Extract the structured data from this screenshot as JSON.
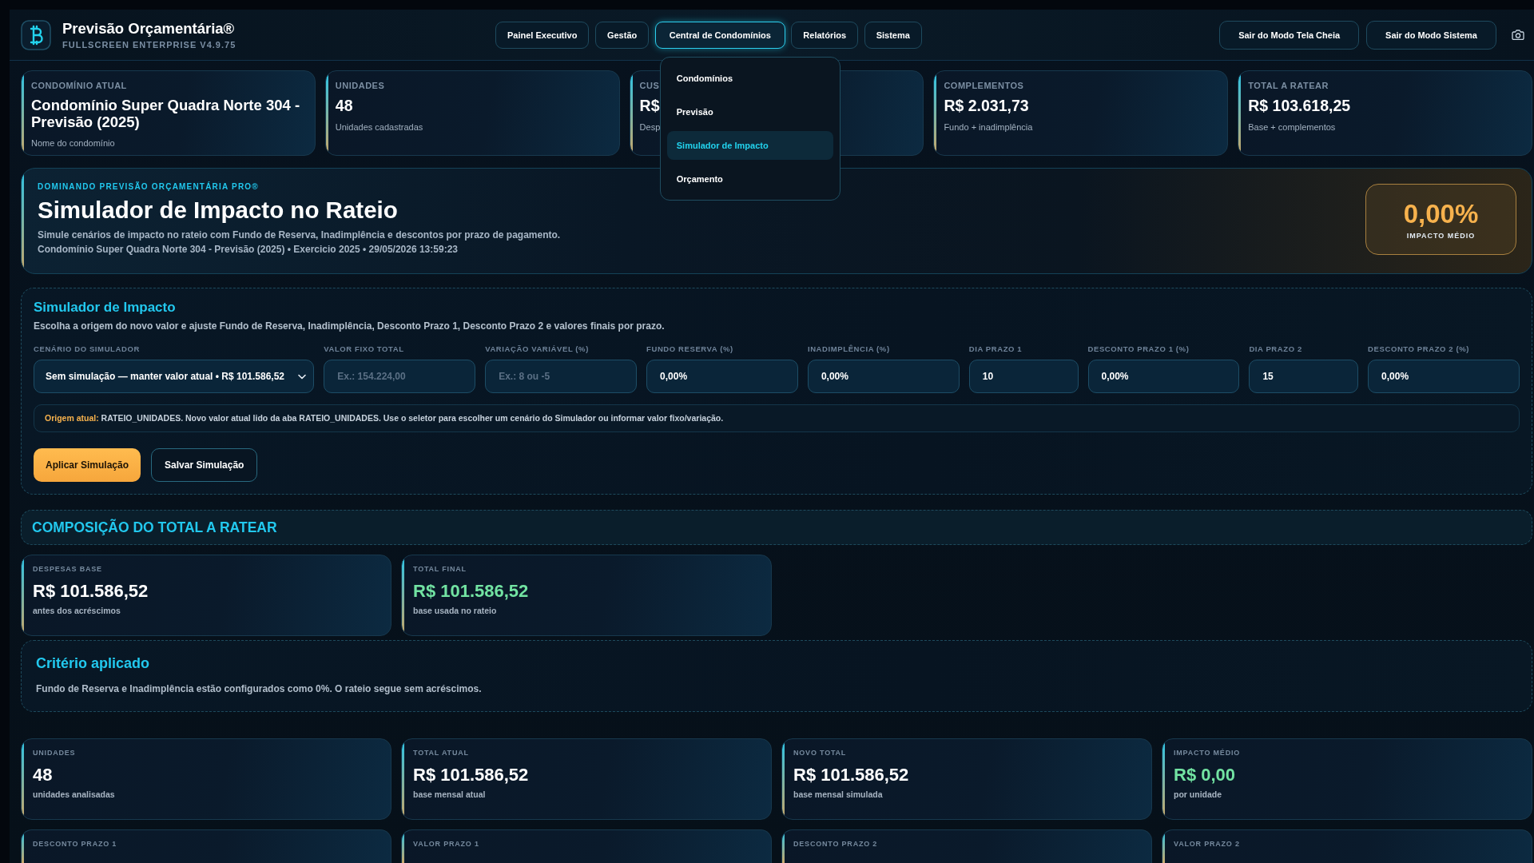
{
  "app": {
    "title": "Previsão Orçamentária®",
    "subtitle": "FULLSCREEN ENTERPRISE V4.9.75"
  },
  "nav": [
    {
      "label": "Painel Executivo",
      "selected": false,
      "expanded": false
    },
    {
      "label": "Gestão",
      "selected": false,
      "expanded": false
    },
    {
      "label": "Central de Condomínios",
      "selected": true,
      "expanded": true,
      "menu": [
        {
          "label": "Condomínios",
          "selected": false
        },
        {
          "label": "Previsão",
          "selected": false
        },
        {
          "label": "Simulador de Impacto",
          "selected": true
        },
        {
          "label": "Orçamento",
          "selected": false
        }
      ]
    },
    {
      "label": "Relatórios",
      "selected": false,
      "expanded": false
    },
    {
      "label": "Sistema",
      "selected": false,
      "expanded": false
    }
  ],
  "header_actions": [
    "Sair do Modo Tela Cheia",
    "Sair do Modo Sistema"
  ],
  "summary_cards": [
    {
      "label": "CONDOMÍNIO ATUAL",
      "value": "Condomínio Super Quadra Norte 304 - Previsão (2025)",
      "caption": "Nome do condomínio",
      "kind": "text"
    },
    {
      "label": "UNIDADES",
      "value": "48",
      "caption": "Unidades cadastradas",
      "kind": "amount"
    },
    {
      "label": "CUS",
      "value": "R$",
      "caption": "Desp",
      "kind": "amount"
    },
    {
      "label": "COMPLEMENTOS",
      "value": "R$ 2.031,73",
      "caption": "Fundo + inadimplência",
      "kind": "amount"
    },
    {
      "label": "TOTAL A RATEAR",
      "value": "R$ 103.618,25",
      "caption": "Base + complementos",
      "kind": "amount"
    }
  ],
  "hero": {
    "kicker": "DOMINANDO PREVISÃO ORÇAMENTÁRIA PRO®",
    "title": "Simulador de Impacto no Rateio",
    "description": "Simule cenários de impacto no rateio com Fundo de Reserva, Inadimplência e descontos por prazo de pagamento.",
    "context": "Condomínio Super Quadra Norte 304 - Previsão (2025) • Exercicio 2025 • 29/05/2026 13:59:23",
    "impact": {
      "value": "0,00%",
      "label": "IMPACTO MÉDIO"
    }
  },
  "simulator": {
    "title": "Simulador de Impacto",
    "description": "Escolha a origem do novo valor e ajuste Fundo de Reserva, Inadimplência, Desconto Prazo 1, Desconto Prazo 2 e valores finais por prazo.",
    "fields": [
      {
        "kind": "select",
        "label": "CENÁRIO DO SIMULADOR",
        "value": "Sem simulação — manter valor atual • R$ 101.586,52"
      },
      {
        "kind": "input",
        "label": "VALOR FIXO TOTAL",
        "placeholder": "Ex.: 154.224,00"
      },
      {
        "kind": "input",
        "label": "VARIAÇÃO VARIÁVEL (%)",
        "placeholder": "Ex.: 8 ou -5"
      },
      {
        "kind": "input",
        "label": "FUNDO RESERVA (%)",
        "value": "0,00%"
      },
      {
        "kind": "input",
        "label": "INADIMPLÊNCIA (%)",
        "value": "0,00%"
      },
      {
        "kind": "input",
        "label": "DIA PRAZO 1",
        "value": "10"
      },
      {
        "kind": "input",
        "label": "DESCONTO PRAZO 1 (%)",
        "value": "0,00%"
      },
      {
        "kind": "input",
        "label": "DIA PRAZO 2",
        "value": "15"
      },
      {
        "kind": "input",
        "label": "DESCONTO PRAZO 2 (%)",
        "value": "0,00%"
      }
    ],
    "note": "**Origem atual:** RATEIO_UNIDADES. Novo valor atual lido da aba RATEIO_UNIDADES. Use o seletor para escolher um cenário do Simulador ou informar valor fixo/variação.",
    "buttons": [
      {
        "label": "Aplicar Simulação",
        "kind": "primary"
      },
      {
        "label": "Salvar Simulação",
        "kind": "secondary"
      }
    ]
  },
  "composition": {
    "title": "COMPOSIÇÃO DO TOTAL A RATEAR",
    "cards": [
      {
        "label": "DESPESAS BASE",
        "value": "R$ 101.586,52",
        "caption": "antes dos acréscimos",
        "kind": "plain"
      },
      {
        "label": "TOTAL FINAL",
        "value": "R$ 101.586,52",
        "caption": "base usada no rateio",
        "kind": "positive"
      }
    ]
  },
  "criteria": {
    "title": "Critério aplicado",
    "text": "Fundo de Reserva e Inadimplência estão configurados como 0%. O rateio segue sem acréscimos."
  },
  "metrics": [
    {
      "label": "UNIDADES",
      "value": "48",
      "caption": "unidades analisadas",
      "kind": "plain"
    },
    {
      "label": "TOTAL ATUAL",
      "value": "R$ 101.586,52",
      "caption": "base mensal atual",
      "kind": "plain"
    },
    {
      "label": "NOVO TOTAL",
      "value": "R$ 101.586,52",
      "caption": "base mensal simulada",
      "kind": "plain"
    },
    {
      "label": "IMPACTO MÉDIO",
      "value": "R$ 0,00",
      "caption": "por unidade",
      "kind": "positive"
    },
    {
      "label": "DESCONTO PRAZO 1"
    },
    {
      "label": "VALOR PRAZO 1"
    },
    {
      "label": "DESCONTO PRAZO 2"
    },
    {
      "label": "VALOR PRAZO 2"
    }
  ]
}
